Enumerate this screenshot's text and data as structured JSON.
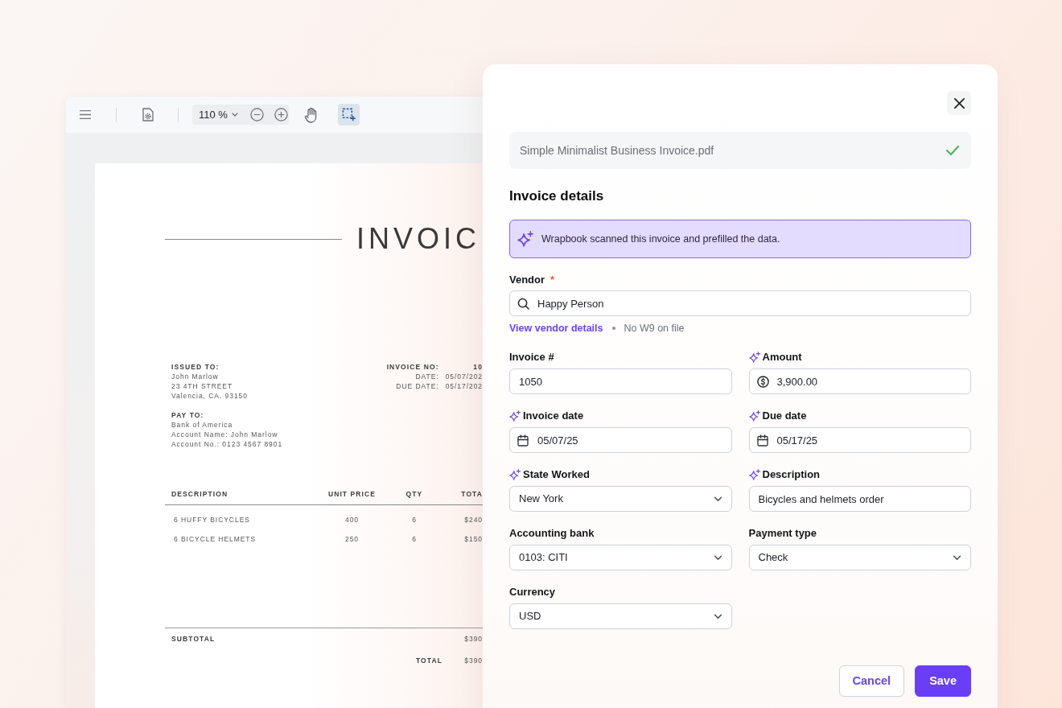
{
  "viewer": {
    "toolbar": {
      "zoom": "110 %",
      "tools": [
        {
          "kind": "hand",
          "selected": false
        },
        {
          "kind": "area-select",
          "selected": true
        }
      ]
    },
    "document": {
      "title": "INVOIC",
      "issued_to": {
        "heading": "ISSUED TO:",
        "lines": [
          "John Marlow",
          "23 4TH STREET",
          "Valencia, CA. 93150"
        ]
      },
      "pay_to": {
        "heading": "PAY TO:",
        "lines": [
          "Bank of America",
          "Account Name: John Marlow",
          "Account No.: 0123 4567 8901"
        ]
      },
      "meta": [
        {
          "label": "INVOICE NO:",
          "value": "10",
          "kind": "primary"
        },
        {
          "label": "DATE:",
          "value": "05/07/202",
          "kind": "secondary"
        },
        {
          "label": "DUE DATE:",
          "value": "05/17/202",
          "kind": "secondary"
        }
      ],
      "table": {
        "columns": [
          "DESCRIPTION",
          "UNIT PRICE",
          "QTY",
          "TOTA"
        ],
        "rows": [
          [
            "6 HUFFY BICYCLES",
            "400",
            "6",
            "$240"
          ],
          [
            "6 BICYCLE HELMETS",
            "250",
            "6",
            "$150"
          ]
        ]
      },
      "subtotal": {
        "label": "SUBTOTAL",
        "value": "$390"
      },
      "total": {
        "label": "TOTAL",
        "value": "$390"
      }
    }
  },
  "panel": {
    "file": {
      "name": "Simple Minimalist Business Invoice.pdf",
      "verified": true
    },
    "title": "Invoice details",
    "notice": "Wrapbook scanned this invoice and prefilled the data.",
    "vendor": {
      "label": "Vendor",
      "required_mark": "*",
      "value": "Happy Person",
      "link": "View vendor details",
      "note": "No W9 on file"
    },
    "fields": [
      {
        "label": "Invoice #",
        "kind": "text",
        "value": "1050",
        "prefilled": false
      },
      {
        "label": "Amount",
        "kind": "currency",
        "value": "3,900.00",
        "prefilled": true
      },
      {
        "label": "Invoice date",
        "kind": "date",
        "value": "05/07/25",
        "prefilled": true
      },
      {
        "label": "Due date",
        "kind": "date",
        "value": "05/17/25",
        "prefilled": true
      },
      {
        "label": "State Worked",
        "kind": "select",
        "value": "New York",
        "prefilled": true
      },
      {
        "label": "Description",
        "kind": "text",
        "value": "Bicycles and helmets order",
        "prefilled": true
      },
      {
        "label": "Accounting bank",
        "kind": "select",
        "value": "0103: CITI",
        "prefilled": false
      },
      {
        "label": "Payment type",
        "kind": "select",
        "value": "Check",
        "prefilled": false
      },
      {
        "label": "Currency",
        "kind": "select",
        "value": "USD",
        "prefilled": false
      }
    ],
    "buttons": [
      {
        "label": "Cancel",
        "kind": "secondary"
      },
      {
        "label": "Save",
        "kind": "primary"
      }
    ]
  }
}
